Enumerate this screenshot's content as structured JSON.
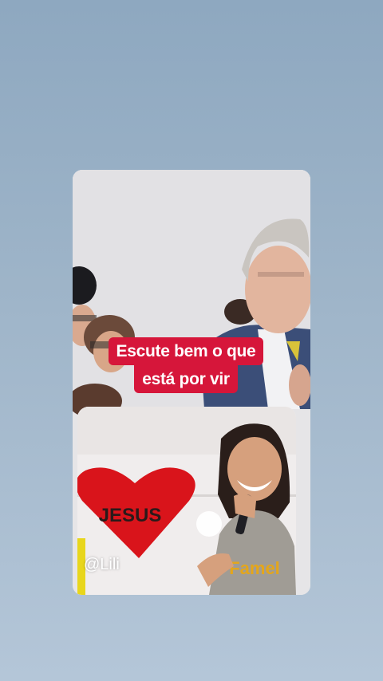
{
  "caption": {
    "line1": "Escute bem o que",
    "line2": "está por vir"
  },
  "sign": {
    "text": "JESUS"
  },
  "shirt_text": "Famel",
  "username": "@Lili",
  "colors": {
    "background_top": "#8ea8c0",
    "background_bottom": "#b4c6d8",
    "caption_bg": "#d6163a",
    "heart_red": "#d9141b"
  },
  "icons": [
    "microphone-icon",
    "heart-sign-icon"
  ]
}
